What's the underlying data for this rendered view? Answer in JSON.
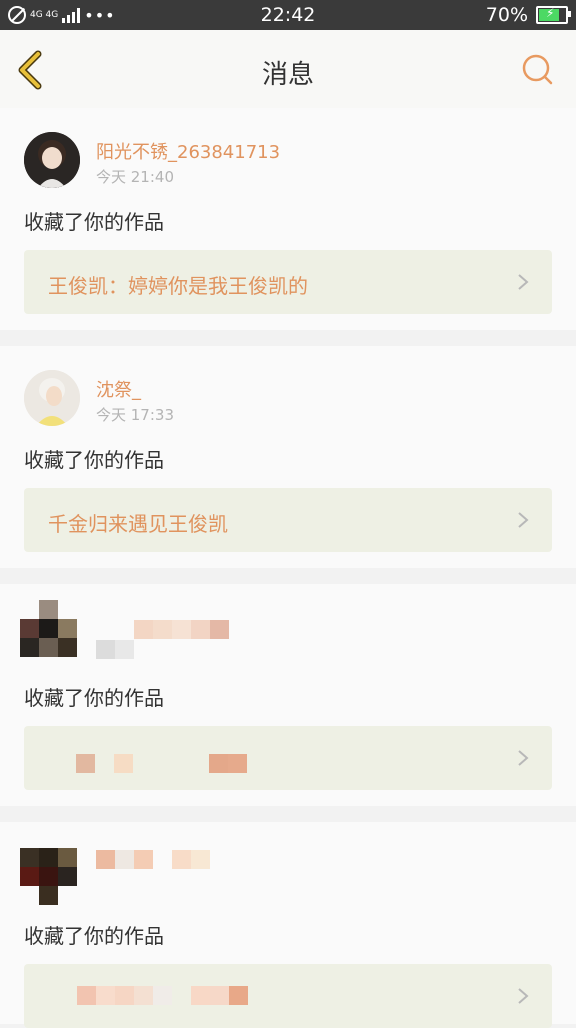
{
  "status_bar": {
    "network": "4G 4G",
    "time": "22:42",
    "battery": "70%"
  },
  "header": {
    "title": "消息"
  },
  "messages": [
    {
      "username": "阳光不锈_263841713",
      "time": "今天 21:40",
      "action": "收藏了你的作品",
      "work_title": "王俊凯：婷婷你是我王俊凯的"
    },
    {
      "username": "沈祭_",
      "time": "今天 17:33",
      "action": "收藏了你的作品",
      "work_title": "千金归来遇见王俊凯"
    },
    {
      "username": "",
      "time": "",
      "action": "收藏了你的作品",
      "work_title": ""
    },
    {
      "username": "",
      "time": "",
      "action": "收藏了你的作品",
      "work_title": ""
    }
  ],
  "colors": {
    "accent": "#e0935e",
    "back_icon": "#e0b83a",
    "work_bg": "#eef0e4"
  },
  "icons": {
    "back": "back-chevron-icon",
    "search": "search-icon",
    "chevron": "chevron-right-icon"
  }
}
